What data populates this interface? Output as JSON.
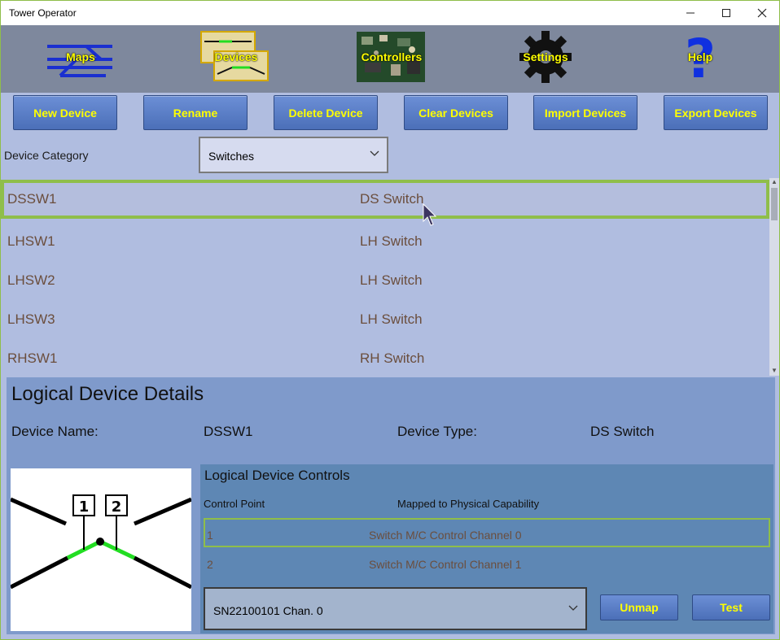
{
  "window": {
    "title": "Tower Operator"
  },
  "nav": {
    "items": [
      {
        "label": "Maps",
        "icon": "maps-icon"
      },
      {
        "label": "Devices",
        "icon": "devices-icon"
      },
      {
        "label": "Controllers",
        "icon": "controllers-icon"
      },
      {
        "label": "Settings",
        "icon": "gear-icon"
      },
      {
        "label": "Help",
        "icon": "question-icon"
      }
    ]
  },
  "toolbar": {
    "new_device": "New Device",
    "rename": "Rename",
    "delete_device": "Delete Device",
    "clear_devices": "Clear Devices",
    "import_devices": "Import Devices",
    "export_devices": "Export Devices"
  },
  "category": {
    "label": "Device Category",
    "value": "Switches"
  },
  "devices": [
    {
      "name": "DSSW1",
      "type": "DS Switch",
      "selected": true
    },
    {
      "name": "LHSW1",
      "type": "LH Switch"
    },
    {
      "name": "LHSW2",
      "type": "LH Switch"
    },
    {
      "name": "LHSW3",
      "type": "LH Switch"
    },
    {
      "name": "RHSW1",
      "type": "RH Switch"
    }
  ],
  "details": {
    "title": "Logical Device Details",
    "name_label": "Device Name:",
    "name_value": "DSSW1",
    "type_label": "Device Type:",
    "type_value": "DS Switch",
    "diagram_points": [
      "1",
      "2"
    ]
  },
  "controls": {
    "title": "Logical Device Controls",
    "col_point": "Control Point",
    "col_mapped": "Mapped to Physical Capability",
    "rows": [
      {
        "point": "1",
        "mapped": "Switch M/C Control Channel 0",
        "selected": true
      },
      {
        "point": "2",
        "mapped": "Switch M/C Control Channel 1"
      }
    ],
    "physical_select": "SN22100101 Chan. 0",
    "unmap": "Unmap",
    "test": "Test"
  },
  "colors": {
    "accent_button_text": "#ffff00",
    "selection_border": "#8fbe4a",
    "list_text": "#6b4e3d"
  }
}
